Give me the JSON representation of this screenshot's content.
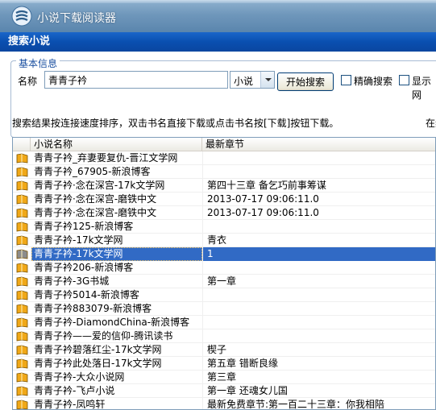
{
  "app": {
    "title": "小说下载阅读器"
  },
  "dialog": {
    "title": "搜索小说",
    "group_title": "基本信息",
    "name_label": "名称",
    "name_value": "青青子衿",
    "type_value": "小说",
    "start_button": "开始搜索",
    "exact_label": "精确搜索",
    "show_label": "显示网",
    "hint": "搜索结果按连接速度排序，双击书名直接下载或点击书名按[下载]按钮下载。",
    "hint_right": "在线"
  },
  "results": {
    "columns": [
      "小说名称",
      "最新章节"
    ],
    "selected_index": 7,
    "rows": [
      {
        "name": "青青子衿_弃妻要复仇-晋江文学网",
        "chapter": ""
      },
      {
        "name": "青青子衿_67905-新浪博客",
        "chapter": ""
      },
      {
        "name": "青青子衿·念在深宫-17k文学网",
        "chapter": "第四十三章 备乞巧前事筹谋"
      },
      {
        "name": "青青子衿·念在深宫-磨铁中文",
        "chapter": "2013-07-17 09:06:11.0"
      },
      {
        "name": "青青子衿·念在深宫-磨铁中文",
        "chapter": "2013-07-17 09:06:11.0"
      },
      {
        "name": "青青子衿125-新浪博客",
        "chapter": ""
      },
      {
        "name": "青青子衿-17k文学网",
        "chapter": "青衣"
      },
      {
        "name": "青青子衿-17k文学网",
        "chapter": "1"
      },
      {
        "name": "青青子衿206-新浪博客",
        "chapter": ""
      },
      {
        "name": "青青子衿-3G书城",
        "chapter": "第一章"
      },
      {
        "name": "青青子衿5014-新浪博客",
        "chapter": ""
      },
      {
        "name": "青青子衿883079-新浪博客",
        "chapter": ""
      },
      {
        "name": "青青子衿-DiamondChina-新浪博客",
        "chapter": ""
      },
      {
        "name": "青青子衿——爱的信仰-腾讯读书",
        "chapter": ""
      },
      {
        "name": "青青子衿碧落红尘-17k文学网",
        "chapter": "楔子"
      },
      {
        "name": "青青子衿此处落日-17k文学网",
        "chapter": "第五章 错断良缘"
      },
      {
        "name": "青青子衿-大众小说网",
        "chapter": "第三章"
      },
      {
        "name": "青青子衿-飞卢小说",
        "chapter": "第一章 还魂女儿国"
      },
      {
        "name": "青青子衿-凤鸣轩",
        "chapter": "最新免费章节:第一百二十三章：你我相陪"
      }
    ]
  },
  "colors": {
    "titlebar": "#0a4fb0",
    "selection": "#316ac5",
    "book_icon": "#f0a818",
    "selected_icon": "#8c8c8c"
  },
  "icons": {
    "app_logo": "app-logo-icon",
    "row_icon": "book-icon"
  }
}
